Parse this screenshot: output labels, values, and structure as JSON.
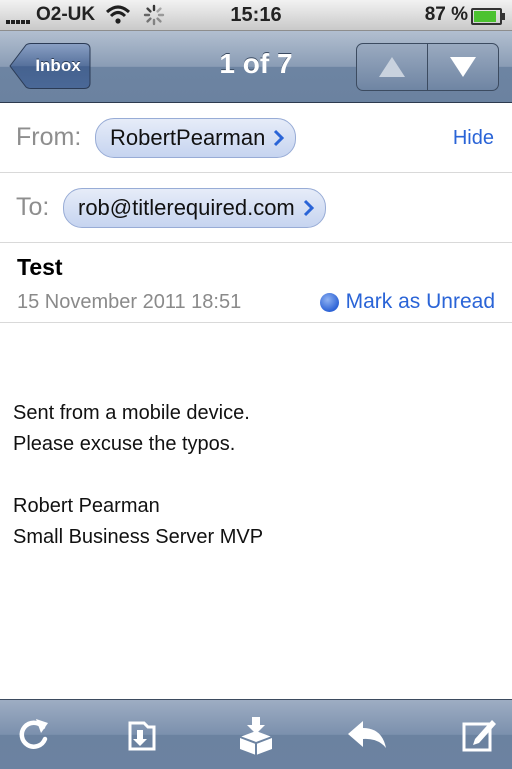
{
  "status_bar": {
    "carrier": "O2-UK",
    "time": "15:16",
    "battery": "87 %"
  },
  "nav_bar": {
    "back_label": "Inbox",
    "title": "1 of 7"
  },
  "header": {
    "from_label": "From:",
    "from_name": "RobertPearman",
    "hide_label": "Hide",
    "to_label": "To:",
    "to_address": "rob@titlerequired.com",
    "subject": "Test",
    "date": "15 November 2011 18:51",
    "mark_unread_label": "Mark as Unread"
  },
  "body": {
    "line1": "Sent from a mobile device.",
    "line2": "Please excuse the typos.",
    "line3": "Robert Pearman",
    "line4": "Small Business Server MVP"
  },
  "toolbar": {
    "icons": [
      "refresh-icon",
      "move-folder-icon",
      "archive-icon",
      "reply-icon",
      "compose-icon"
    ]
  },
  "colors": {
    "link": "#2a64d7",
    "nav": "#6d84a2"
  }
}
